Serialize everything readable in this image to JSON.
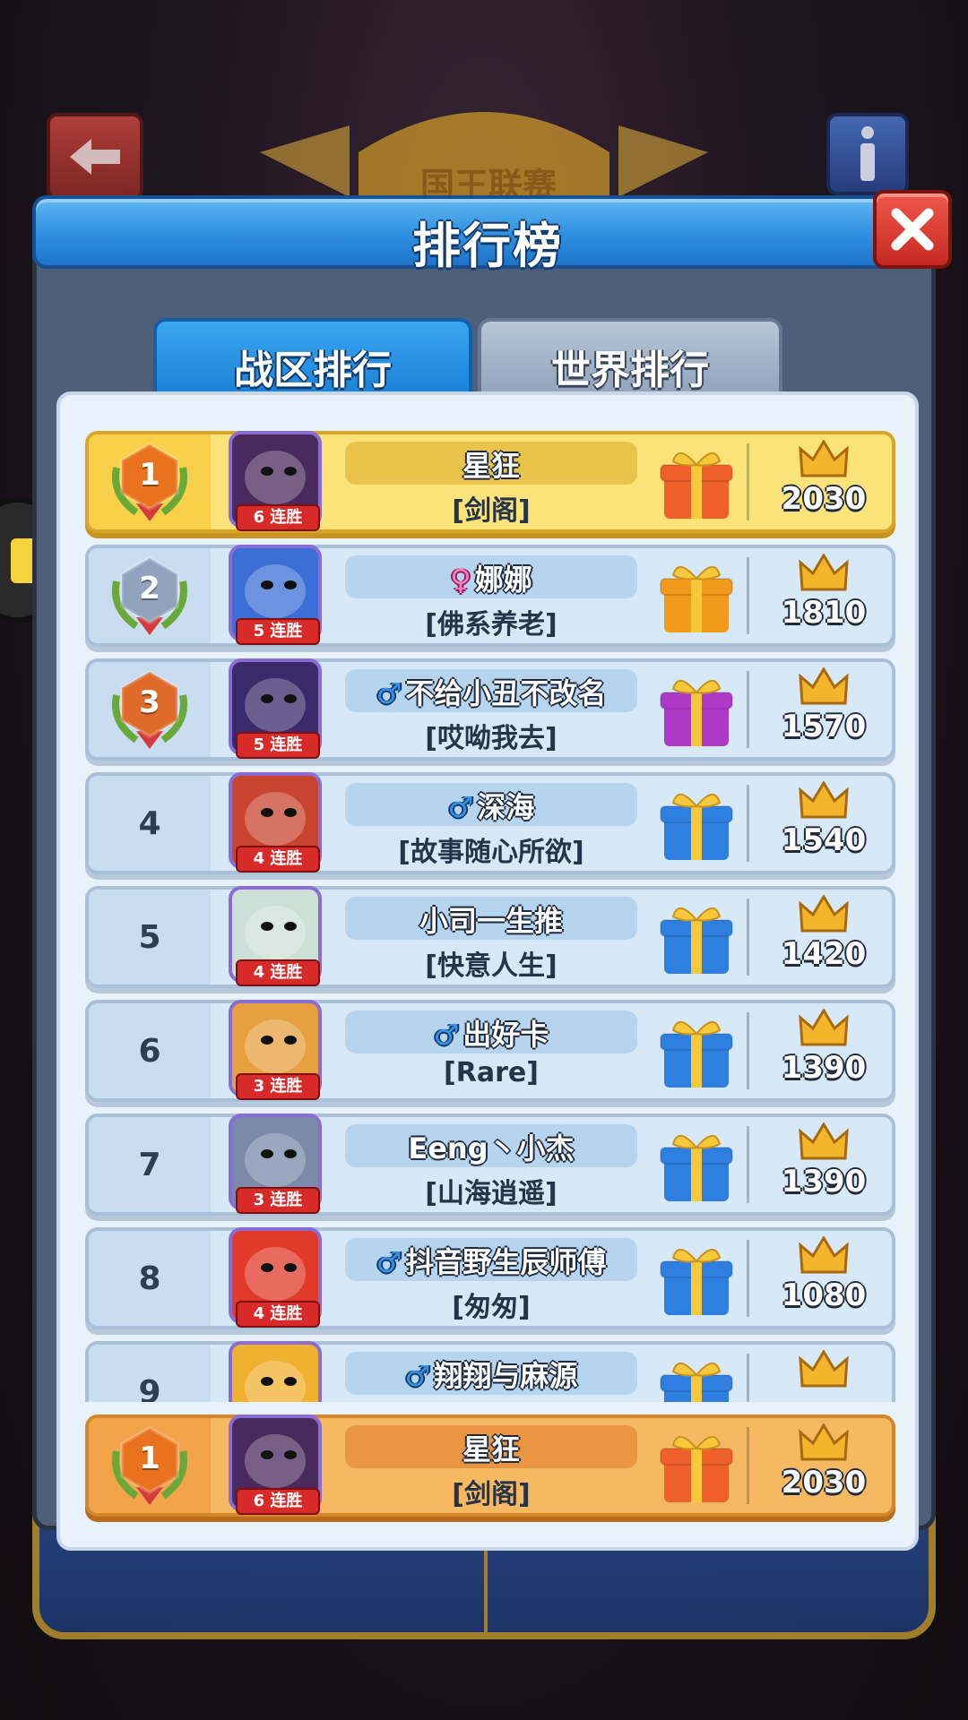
{
  "dialog": {
    "title": "排行榜",
    "tabs": [
      {
        "label": "战区排行",
        "active": true
      },
      {
        "label": "世界排行",
        "active": false
      }
    ]
  },
  "background": {
    "banner_title": "国王联赛"
  },
  "leaderboard": [
    {
      "rank": "1",
      "medal": true,
      "medal_color": "#e8721e",
      "name": "星狂",
      "gender": "",
      "guild": "[剑阁]",
      "streak": "6 连胜",
      "score": "2030",
      "gift_color": "#f0602a",
      "avatar_color": "#4a2a5c",
      "highlight": "gold"
    },
    {
      "rank": "2",
      "medal": true,
      "medal_color": "#8fa3bd",
      "name": "娜娜",
      "gender": "♀",
      "guild": "[佛系养老]",
      "streak": "5 连胜",
      "score": "1810",
      "gift_color": "#f29a1c",
      "avatar_color": "#3b6fd6",
      "highlight": ""
    },
    {
      "rank": "3",
      "medal": true,
      "medal_color": "#e06a2a",
      "name": "不给小丑不改名",
      "gender": "♂",
      "guild": "[哎呦我去]",
      "streak": "5 连胜",
      "score": "1570",
      "gift_color": "#b03ac8",
      "avatar_color": "#3a2a6a",
      "highlight": ""
    },
    {
      "rank": "4",
      "medal": false,
      "medal_color": "",
      "name": "深海",
      "gender": "♂",
      "guild": "[故事随心所欲]",
      "streak": "4 连胜",
      "score": "1540",
      "gift_color": "#2f7fe0",
      "avatar_color": "#c8442e",
      "highlight": ""
    },
    {
      "rank": "5",
      "medal": false,
      "medal_color": "",
      "name": "小司一生推",
      "gender": "",
      "guild": "[快意人生]",
      "streak": "4 连胜",
      "score": "1420",
      "gift_color": "#2f7fe0",
      "avatar_color": "#cde0d8",
      "highlight": ""
    },
    {
      "rank": "6",
      "medal": false,
      "medal_color": "",
      "name": "出好卡",
      "gender": "♂",
      "guild": "[Rare]",
      "streak": "3 连胜",
      "score": "1390",
      "gift_color": "#2f7fe0",
      "avatar_color": "#e6a040",
      "highlight": ""
    },
    {
      "rank": "7",
      "medal": false,
      "medal_color": "",
      "name": "Eeng丶小杰",
      "gender": "",
      "guild": "[山海逍遥]",
      "streak": "3 连胜",
      "score": "1390",
      "gift_color": "#2f7fe0",
      "avatar_color": "#7a8aa8",
      "highlight": ""
    },
    {
      "rank": "8",
      "medal": false,
      "medal_color": "",
      "name": "抖音野生辰师傅",
      "gender": "♂",
      "guild": "[匆匆]",
      "streak": "4 连胜",
      "score": "1080",
      "gift_color": "#2f7fe0",
      "avatar_color": "#e23a2a",
      "highlight": ""
    },
    {
      "rank": "9",
      "medal": false,
      "medal_color": "",
      "name": "翔翔与麻源",
      "gender": "♂",
      "guild": "",
      "streak": "",
      "score": "",
      "gift_color": "#2f7fe0",
      "avatar_color": "#f0b030",
      "highlight": ""
    }
  ],
  "self_entry": {
    "rank": "1",
    "medal_color": "#e8721e",
    "name": "星狂",
    "gender": "",
    "guild": "[剑阁]",
    "streak": "6 连胜",
    "score": "2030",
    "gift_color": "#f0602a",
    "avatar_color": "#4a2a5c"
  },
  "colors": {
    "title_blue": "#2f8fe0",
    "gold_row": "#fbe37a",
    "self_row": "#f7b862",
    "close_red": "#e23a2e"
  }
}
